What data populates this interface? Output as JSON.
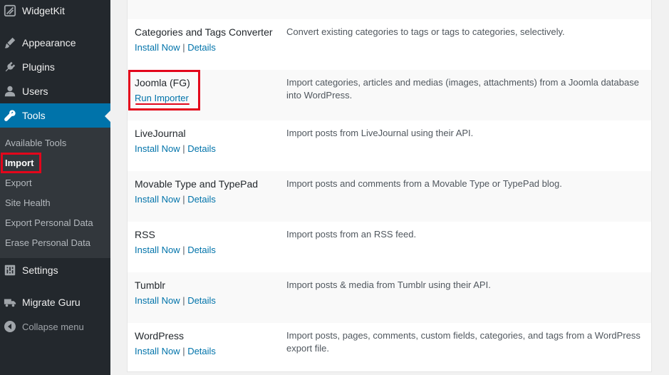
{
  "sidebar": {
    "widgetkit": "WidgetKit",
    "appearance": "Appearance",
    "plugins": "Plugins",
    "users": "Users",
    "tools": "Tools",
    "tools_submenu": [
      "Available Tools",
      "Import",
      "Export",
      "Site Health",
      "Export Personal Data",
      "Erase Personal Data"
    ],
    "settings": "Settings",
    "migrate_guru": "Migrate Guru",
    "collapse": "Collapse menu"
  },
  "importers": [
    {
      "name": "Categories and Tags Converter",
      "action": "Install Now",
      "sep": " | ",
      "details": "Details",
      "description": "Convert existing categories to tags or tags to categories, selectively."
    },
    {
      "name": "Joomla (FG)",
      "action": "Run Importer",
      "description": "Import categories, articles and medias (images, attachments) from a Joomla database into WordPress."
    },
    {
      "name": "LiveJournal",
      "action": "Install Now",
      "sep": " | ",
      "details": "Details",
      "description": "Import posts from LiveJournal using their API."
    },
    {
      "name": "Movable Type and TypePad",
      "action": "Install Now",
      "sep": " | ",
      "details": "Details",
      "description": "Import posts and comments from a Movable Type or TypePad blog."
    },
    {
      "name": "RSS",
      "action": "Install Now",
      "sep": " | ",
      "details": "Details",
      "description": "Import posts from an RSS feed."
    },
    {
      "name": "Tumblr",
      "action": "Install Now",
      "sep": " | ",
      "details": "Details",
      "description": "Import posts & media from Tumblr using their API."
    },
    {
      "name": "WordPress",
      "action": "Install Now",
      "sep": " | ",
      "details": "Details",
      "description": "Import posts, pages, comments, custom fields, categories, and tags from a WordPress export file."
    }
  ],
  "colors": {
    "accent": "#0073aa",
    "highlight": "#e3061b",
    "sidebar": "#23282d"
  }
}
